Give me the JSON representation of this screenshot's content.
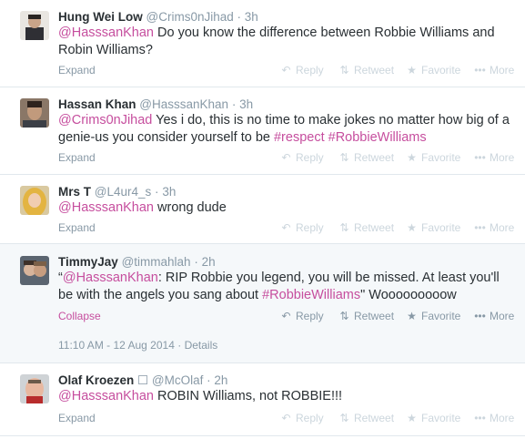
{
  "tweets": [
    {
      "fullname": "Hung Wei Low",
      "username": "@Crims0nJihad",
      "time": "3h",
      "segments": [
        {
          "t": "mention",
          "v": "@HasssanKhan"
        },
        {
          "t": "text",
          "v": " Do you know the difference between Robbie Williams and Robin Williams?"
        }
      ],
      "expand": "Expand"
    },
    {
      "fullname": "Hassan Khan",
      "username": "@HasssanKhan",
      "time": "3h",
      "segments": [
        {
          "t": "mention",
          "v": "@Crims0nJihad"
        },
        {
          "t": "text",
          "v": " Yes i do, this is no time to make jokes no matter how big of a genie-us you consider yourself to be "
        },
        {
          "t": "hashtag",
          "v": "#respect"
        },
        {
          "t": "text",
          "v": " "
        },
        {
          "t": "hashtag",
          "v": "#RobbieWilliams"
        }
      ],
      "expand": "Expand"
    },
    {
      "fullname": "Mrs T",
      "username": "@L4ur4_s",
      "time": "3h",
      "segments": [
        {
          "t": "mention",
          "v": "@HasssanKhan"
        },
        {
          "t": "text",
          "v": " wrong dude"
        }
      ],
      "expand": "Expand"
    },
    {
      "fullname": "TimmyJay",
      "username": "@timmahlah",
      "time": "2h",
      "segments": [
        {
          "t": "text",
          "v": "“"
        },
        {
          "t": "mention",
          "v": "@HasssanKhan"
        },
        {
          "t": "text",
          "v": ": RIP Robbie you legend, you will be missed. At least you'll be with the angels you sang about "
        },
        {
          "t": "hashtag",
          "v": "#RobbieWilliams"
        },
        {
          "t": "text",
          "v": "\" Wooooooooow"
        }
      ],
      "expand": "Collapse",
      "timestamp": "11:10 AM - 12 Aug 2014",
      "details": "Details"
    },
    {
      "fullname": "Olaf Kroezen",
      "verified_glyph": "☐",
      "username": "@McOlaf",
      "time": "2h",
      "segments": [
        {
          "t": "mention",
          "v": "@HasssanKhan"
        },
        {
          "t": "text",
          "v": " ROBIN Williams, not ROBBIE!!!"
        }
      ],
      "expand": "Expand"
    }
  ],
  "actions": {
    "reply": "Reply",
    "retweet": "Retweet",
    "favorite": "Favorite",
    "more": "More",
    "separator": "·"
  },
  "icons": {
    "reply": "reply-arrow-icon",
    "retweet": "retweet-arrows-icon",
    "favorite": "star-icon",
    "more": "ellipsis-icon"
  },
  "colors": {
    "link": "#c64e9e",
    "muted": "#8899a6",
    "faint": "#ccd6dd",
    "text": "#292f33",
    "expanded_bg": "#f5f8fa",
    "divider": "#e1e8ed"
  }
}
